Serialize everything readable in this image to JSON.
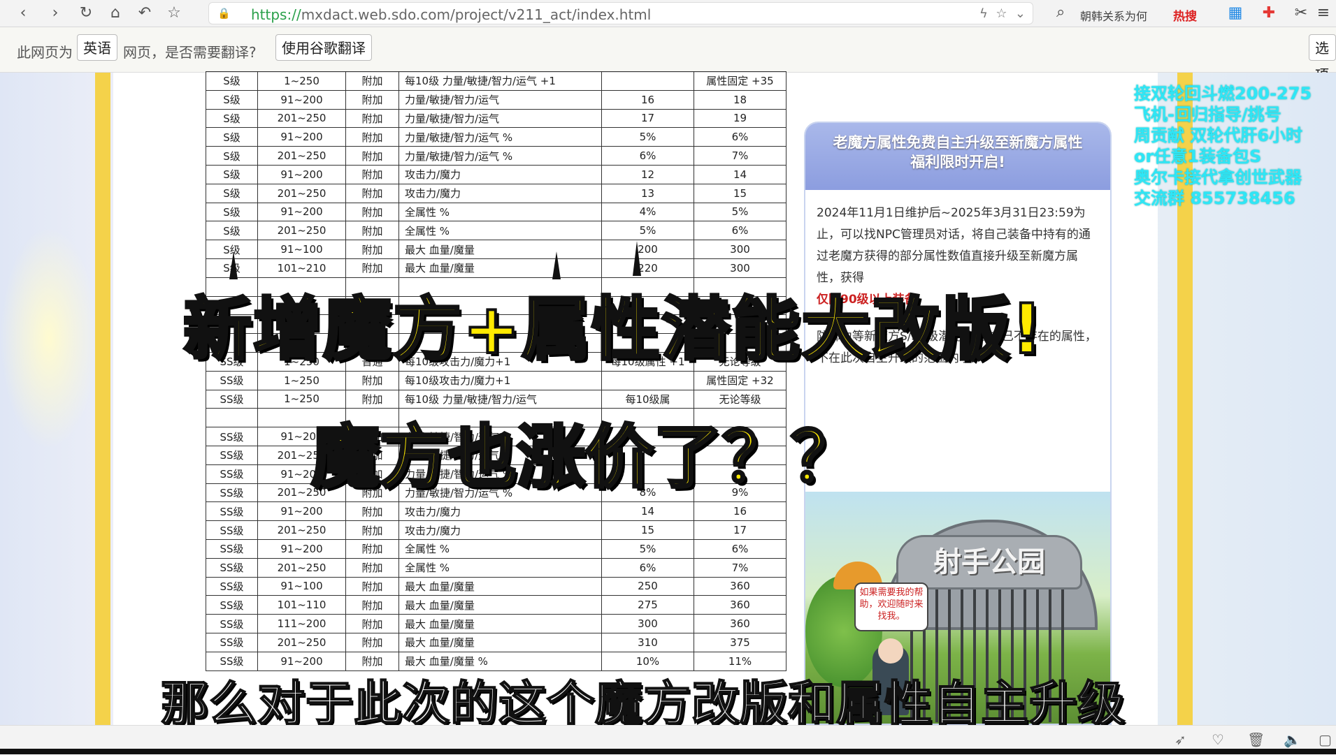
{
  "browser": {
    "url_scheme": "https://",
    "url_rest": "mxdact.web.sdo.com/project/v211_act/index.html",
    "search_text": "朝韩关系为何",
    "search_hot": "热搜"
  },
  "translate_bar": {
    "prefix": "此网页为",
    "language": "英语",
    "question": "网页，是否需要翻译?",
    "translate_button": "使用谷歌翻译",
    "options_button": "选项"
  },
  "table_rows": [
    [
      "S级",
      "1~250",
      "附加",
      "每10级 力量/敏捷/智力/运气 +1",
      "",
      "属性固定 +35"
    ],
    [
      "S级",
      "91~200",
      "附加",
      "力量/敏捷/智力/运气",
      "16",
      "18"
    ],
    [
      "S级",
      "201~250",
      "附加",
      "力量/敏捷/智力/运气",
      "17",
      "19"
    ],
    [
      "S级",
      "91~200",
      "附加",
      "力量/敏捷/智力/运气 %",
      "5%",
      "6%"
    ],
    [
      "S级",
      "201~250",
      "附加",
      "力量/敏捷/智力/运气 %",
      "6%",
      "7%"
    ],
    [
      "S级",
      "91~200",
      "附加",
      "攻击力/魔力",
      "12",
      "14"
    ],
    [
      "S级",
      "201~250",
      "附加",
      "攻击力/魔力",
      "13",
      "15"
    ],
    [
      "S级",
      "91~200",
      "附加",
      "全属性 %",
      "4%",
      "5%"
    ],
    [
      "S级",
      "201~250",
      "附加",
      "全属性 %",
      "5%",
      "6%"
    ],
    [
      "S级",
      "91~100",
      "附加",
      "最大 血量/魔量",
      "200",
      "300"
    ],
    [
      "S级",
      "101~210",
      "附加",
      "最大 血量/魔量",
      "220",
      "300"
    ],
    [
      "",
      "",
      "",
      "",
      "",
      ""
    ],
    [
      "",
      "",
      "",
      "",
      "",
      ""
    ],
    [
      "",
      "",
      "",
      "",
      "",
      ""
    ],
    [
      "",
      "",
      "",
      "",
      "",
      ""
    ],
    [
      "SS级",
      "1~250",
      "普通",
      "每10级攻击力/魔力+1",
      "每10级属性 +1",
      "无论等级"
    ],
    [
      "SS级",
      "1~250",
      "附加",
      "每10级攻击力/魔力+1",
      "",
      "属性固定 +32"
    ],
    [
      "SS级",
      "1~250",
      "附加",
      "每10级 力量/敏捷/智力/运气",
      "每10级属",
      "无论等级"
    ],
    [
      "",
      "",
      "",
      "",
      "",
      ""
    ],
    [
      "SS级",
      "91~200",
      "附加",
      "力量/敏捷/智力/运气",
      "",
      ""
    ],
    [
      "SS级",
      "201~250",
      "附加",
      "力量/敏捷/智力/运气",
      "",
      ""
    ],
    [
      "SS级",
      "91~200",
      "附加",
      "力量/敏捷/智力/运气 %",
      "",
      ""
    ],
    [
      "SS级",
      "201~250",
      "附加",
      "力量/敏捷/智力/运气 %",
      "8%",
      "9%"
    ],
    [
      "SS级",
      "91~200",
      "附加",
      "攻击力/魔力",
      "14",
      "16"
    ],
    [
      "SS级",
      "201~250",
      "附加",
      "攻击力/魔力",
      "15",
      "17"
    ],
    [
      "SS级",
      "91~200",
      "附加",
      "全属性 %",
      "5%",
      "6%"
    ],
    [
      "SS级",
      "201~250",
      "附加",
      "全属性 %",
      "6%",
      "7%"
    ],
    [
      "SS级",
      "91~100",
      "附加",
      "最大 血量/魔量",
      "250",
      "360"
    ],
    [
      "SS级",
      "101~110",
      "附加",
      "最大 血量/魔量",
      "275",
      "360"
    ],
    [
      "SS级",
      "111~200",
      "附加",
      "最大 血量/魔量",
      "300",
      "360"
    ],
    [
      "SS级",
      "201~250",
      "附加",
      "最大 血量/魔量",
      "310",
      "375"
    ],
    [
      "SS级",
      "91~200",
      "附加",
      "最大 血量/魔量 %",
      "10%",
      "11%"
    ]
  ],
  "card": {
    "title_line1": "老魔方属性免费自主升级至新魔方属性",
    "title_line2": "福利限时开启!",
    "para1": "2024年11月1日维护后~2025年3月31日23:59为止，可以找NPC管理员对话，将自己装备中持有的通过老魔方获得的部分属性数值直接升级至新魔方",
    "para1_cont": "属性，获得",
    "red_note": "仅限90级以上装备",
    "para2": "防御力等新魔方S/SS级潜能/附潜中已不存在的属性，不在此次自主升级的范围内哦!",
    "scene_sign": "射手公园",
    "speech": "如果需要我的帮助，欢迎随时来找我。"
  },
  "promo_lines": [
    "接双轮回斗燃200-275",
    "飞机-回归指导/挑号",
    "周贡献 双轮代肝6小时",
    "or任意1装备包S",
    "奥尔卡接代拿创世武器",
    "交流群 855738456"
  ],
  "headline": "新增魔方+属性潜能大改版!",
  "subheadline": "魔方也涨价了？？",
  "caption": "那么对于此次的这个魔方改版和属性自主升级",
  "colors": {
    "headline": "#ffea00",
    "promo": "#2ee6f6",
    "stripe": "#f4d24a"
  }
}
